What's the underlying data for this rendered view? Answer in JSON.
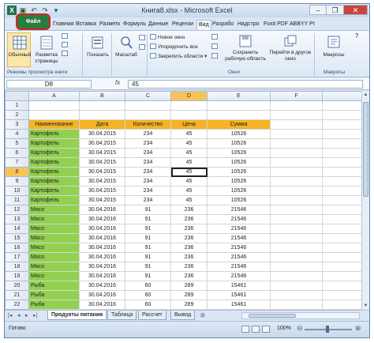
{
  "window": {
    "title": "Книга8.xlsx - Microsoft Excel",
    "controls": [
      "–",
      "❐",
      "✕"
    ]
  },
  "ribbon_tabs": [
    "Файл",
    "Главная",
    "Вставка",
    "Разметк",
    "Формуль",
    "Данные",
    "Рецензи",
    "Вид",
    "Разрабо",
    "Надстро",
    "Foxit PDF",
    "ABBYY PI"
  ],
  "ribbon": {
    "normal": "Обычный",
    "page_layout": "Разметка страницы",
    "show": "Показать",
    "zoom": "Масштаб",
    "new_window": "Новое окно",
    "arrange_all": "Упорядочить все",
    "freeze_panes": "Закрепить области",
    "save_workspace": "Сохранить рабочую область",
    "switch_windows": "Перейти в другое окно",
    "macros": "Макросы",
    "group_views": "Режимы просмотра книги",
    "group_window": "Окно",
    "group_macros": "Макросы"
  },
  "formula_bar": {
    "namebox": "D8",
    "fx": "fx",
    "value": "45"
  },
  "sheet": {
    "columns": [
      "A",
      "B",
      "C",
      "D",
      "E",
      "F"
    ],
    "header_row": [
      "Наименование",
      "Дата",
      "Количество",
      "Цена",
      "Сумма"
    ],
    "rows": [
      {
        "n": "1",
        "cells": []
      },
      {
        "n": "2",
        "cells": []
      },
      {
        "n": "3",
        "cells": [
          "Наименование",
          "Дата",
          "Количество",
          "Цена",
          "Сумма"
        ]
      },
      {
        "n": "4",
        "cells": [
          "Картофель",
          "30.04.2015",
          "234",
          "45",
          "10526"
        ]
      },
      {
        "n": "5",
        "cells": [
          "Картофель",
          "30.04.2015",
          "234",
          "45",
          "10526"
        ]
      },
      {
        "n": "6",
        "cells": [
          "Картофель",
          "30.04.2015",
          "234",
          "45",
          "10526"
        ]
      },
      {
        "n": "7",
        "cells": [
          "Картофель",
          "30.04.2015",
          "234",
          "45",
          "10526"
        ]
      },
      {
        "n": "8",
        "cells": [
          "Картофель",
          "30.04.2015",
          "234",
          "45",
          "10526"
        ]
      },
      {
        "n": "9",
        "cells": [
          "Картофель",
          "30.04.2015",
          "234",
          "45",
          "10526"
        ]
      },
      {
        "n": "10",
        "cells": [
          "Картофель",
          "30.04.2015",
          "234",
          "45",
          "10526"
        ]
      },
      {
        "n": "11",
        "cells": [
          "Картофель",
          "30.04.2015",
          "234",
          "45",
          "10526"
        ]
      },
      {
        "n": "12",
        "cells": [
          "Мясо",
          "30.04.2016",
          "91",
          "236",
          "21546"
        ]
      },
      {
        "n": "13",
        "cells": [
          "Мясо",
          "30.04.2016",
          "91",
          "236",
          "21546"
        ]
      },
      {
        "n": "14",
        "cells": [
          "Мясо",
          "30.04.2016",
          "91",
          "236",
          "21546"
        ]
      },
      {
        "n": "15",
        "cells": [
          "Мясо",
          "30.04.2016",
          "91",
          "236",
          "21546"
        ]
      },
      {
        "n": "16",
        "cells": [
          "Мясо",
          "30.04.2016",
          "91",
          "236",
          "21546"
        ]
      },
      {
        "n": "17",
        "cells": [
          "Мясо",
          "30.04.2016",
          "91",
          "236",
          "21546"
        ]
      },
      {
        "n": "18",
        "cells": [
          "Мясо",
          "30.04.2016",
          "91",
          "236",
          "21546"
        ]
      },
      {
        "n": "19",
        "cells": [
          "Мясо",
          "30.04.2016",
          "91",
          "236",
          "21546"
        ]
      },
      {
        "n": "20",
        "cells": [
          "Рыба",
          "30.04.2016",
          "60",
          "289",
          "15461"
        ]
      },
      {
        "n": "21",
        "cells": [
          "Рыба",
          "30.04.2016",
          "60",
          "289",
          "15461"
        ]
      },
      {
        "n": "22",
        "cells": [
          "Рыба",
          "30.04.2016",
          "60",
          "289",
          "15461"
        ]
      },
      {
        "n": "23",
        "cells": [
          "Рыба",
          "30.04.2016",
          "60",
          "289",
          "15461"
        ]
      },
      {
        "n": "24",
        "cells": [
          "Рыба",
          "30.04.2016",
          "60",
          "289",
          "15461"
        ]
      },
      {
        "n": "25",
        "cells": [
          "Рыба",
          "30.04.2016",
          "60",
          "289",
          "15461"
        ]
      }
    ],
    "active_cell": "D8"
  },
  "sheet_tabs": [
    "Продукты питания",
    "Таблица",
    "Рассчет",
    "Вывод"
  ],
  "status": {
    "ready": "Готово",
    "zoom": "100%"
  },
  "icons": {
    "excel_logo": "excel-logo-icon",
    "save": "save-icon",
    "undo": "undo-icon",
    "redo": "redo-icon"
  },
  "colors": {
    "header_fill": "#f5b325",
    "name_fill": "#92d050",
    "file_tab": "#2a7d3e",
    "highlight_ring": "#d6231f"
  }
}
